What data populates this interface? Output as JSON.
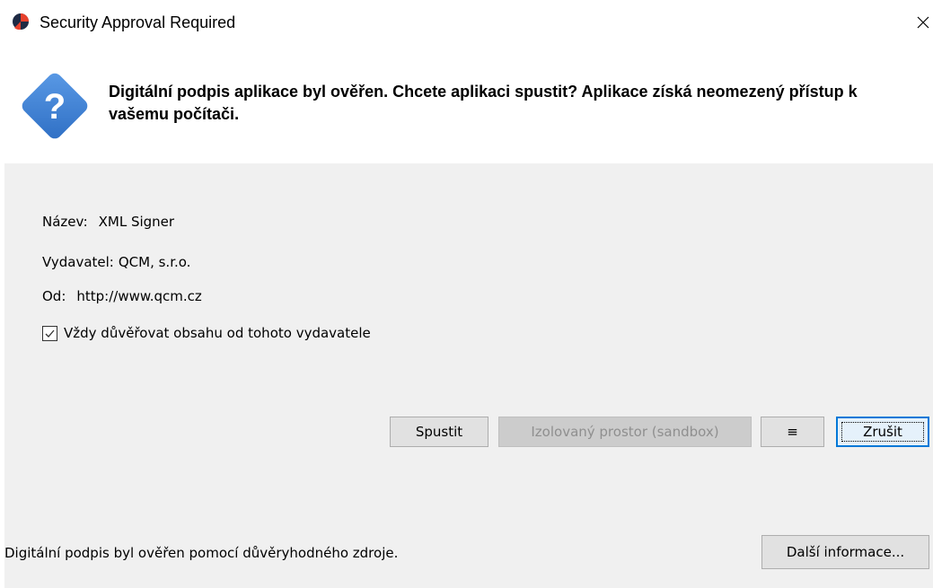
{
  "window": {
    "title": "Security Approval Required",
    "close_glyph": "×"
  },
  "header": {
    "icon": "question-icon",
    "icon_glyph": "?",
    "message": "Digitální podpis aplikace byl ověřen. Chcete aplikaci spustit? Aplikace získá neomezený přístup k vašemu počítači."
  },
  "details": {
    "name_label": "Název:",
    "name_value": "XML Signer",
    "publisher_label": "Vydavatel:",
    "publisher_value": "QCM, s.r.o.",
    "from_label": "Od:",
    "from_value": "http://www.qcm.cz"
  },
  "trust_checkbox": {
    "label": "Vždy důvěřovat obsahu od tohoto vydavatele",
    "checked": true
  },
  "buttons": {
    "run": "Spustit",
    "sandbox": "Izolovaný prostor (sandbox)",
    "sandbox_enabled": false,
    "menu": "≡",
    "cancel": "Zrušit",
    "more_info": "Další informace..."
  },
  "footer": {
    "status": "Digitální podpis byl ověřen pomocí důvěryhodného zdroje."
  },
  "colors": {
    "body_background": "#f0f0f0",
    "icon_blue": "#3b7fd4",
    "focus_blue": "#0078d7"
  }
}
